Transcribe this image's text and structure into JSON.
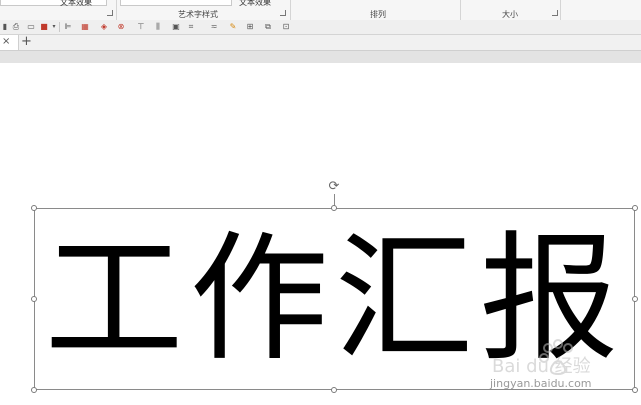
{
  "ribbon": {
    "truncated_1": "文本效果",
    "group_wordart": "艺术字样式",
    "truncated_2": "文本效果",
    "group_arrange": "排列",
    "group_size": "大小"
  },
  "tabs": {
    "close": "×",
    "add": "+"
  },
  "slide": {
    "wordart_text": "工作汇报"
  },
  "watermark": {
    "logo_text": "Bai du 经验",
    "url": "jingyan.baidu.com"
  }
}
